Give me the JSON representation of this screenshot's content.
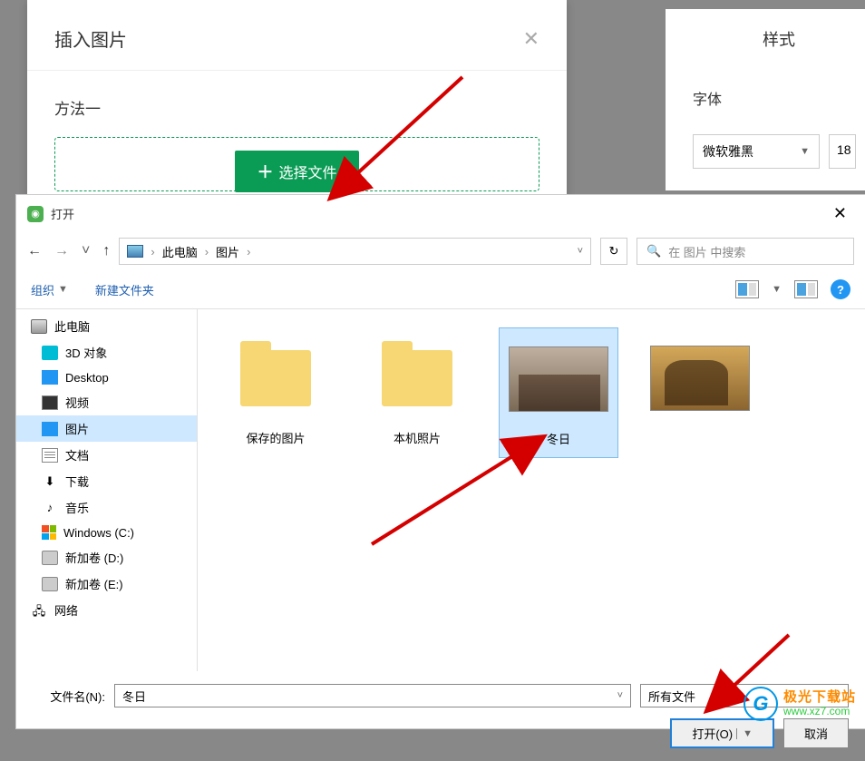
{
  "bgModal": {
    "title": "插入图片",
    "method": "方法一",
    "selectFile": "选择文件"
  },
  "rightPanel": {
    "title": "样式",
    "fontLabel": "字体",
    "fontValue": "微软雅黑",
    "fontSize": "18"
  },
  "dialog": {
    "title": "打开",
    "path": {
      "root": "此电脑",
      "folder": "图片"
    },
    "searchPlaceholder": "在 图片 中搜索",
    "toolbar": {
      "organize": "组织",
      "newFolder": "新建文件夹"
    },
    "tree": [
      {
        "label": "此电脑",
        "icon": "pc",
        "level": 0
      },
      {
        "label": "3D 对象",
        "icon": "3d",
        "level": 1
      },
      {
        "label": "Desktop",
        "icon": "desktop",
        "level": 1
      },
      {
        "label": "视频",
        "icon": "video",
        "level": 1
      },
      {
        "label": "图片",
        "icon": "pics",
        "level": 1,
        "selected": true
      },
      {
        "label": "文档",
        "icon": "docs",
        "level": 1
      },
      {
        "label": "下载",
        "icon": "download",
        "level": 1
      },
      {
        "label": "音乐",
        "icon": "music",
        "level": 1
      },
      {
        "label": "Windows (C:)",
        "icon": "win",
        "level": 1
      },
      {
        "label": "新加卷 (D:)",
        "icon": "drive",
        "level": 1
      },
      {
        "label": "新加卷 (E:)",
        "icon": "drive",
        "level": 1
      },
      {
        "label": "网络",
        "icon": "net",
        "level": 0
      }
    ],
    "files": [
      {
        "label": "保存的图片",
        "type": "folder"
      },
      {
        "label": "本机照片",
        "type": "folder"
      },
      {
        "label": "冬日",
        "type": "image1",
        "selected": true
      },
      {
        "label": "　　　",
        "type": "image2",
        "blurred": true
      }
    ],
    "filenameLabel": "文件名(N):",
    "filenameValue": "冬日",
    "filetype": "所有文件",
    "openBtn": "打开(O)",
    "cancelBtn": "取消"
  },
  "watermark": {
    "cn": "极光下载站",
    "url": "www.xz7.com",
    "logo": "G"
  }
}
